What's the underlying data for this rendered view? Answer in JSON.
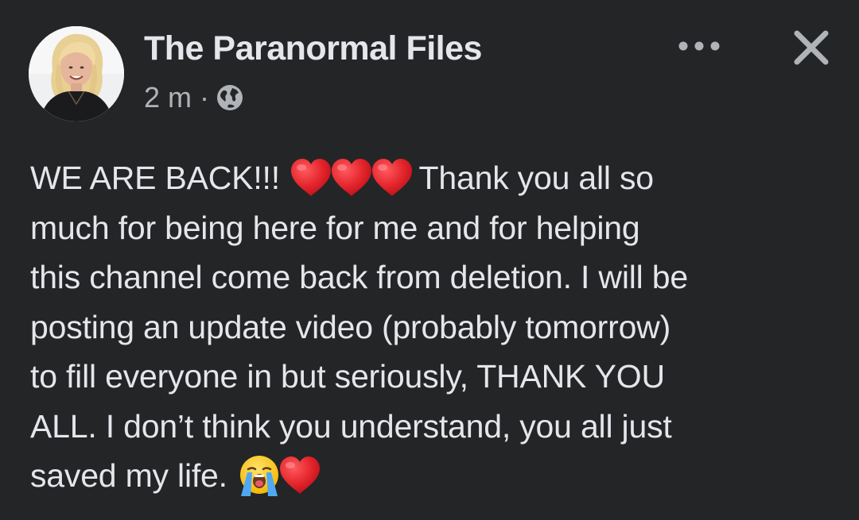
{
  "post": {
    "author": "The Paranormal Files",
    "timestamp": "2 m",
    "separator": "·",
    "audience_icon": "globe-icon",
    "more_icon": "more-options-icon",
    "close_icon": "close-icon",
    "avatar_icon": "avatar",
    "text_lines": [
      {
        "pre": "WE ARE BACK!!! ",
        "post": " Thank you all so"
      },
      {
        "text": "much for being here for me and for helping"
      },
      {
        "text": "this channel come back from deletion. I will be"
      },
      {
        "text": "posting an update video (probably tomorrow)"
      },
      {
        "text": "to fill everyone in but seriously, THANK YOU"
      },
      {
        "text": "ALL. I don’t think you understand, you all just"
      },
      {
        "pre": "saved my life. "
      }
    ],
    "emojis": {
      "line1": [
        "red-heart",
        "red-heart",
        "red-heart"
      ],
      "line7": [
        "loudly-crying-face",
        "red-heart"
      ]
    }
  },
  "colors": {
    "background": "#242526",
    "primary_text": "#e4e6eb",
    "secondary_text": "#b0b3b8",
    "heart": "#e0202a"
  }
}
